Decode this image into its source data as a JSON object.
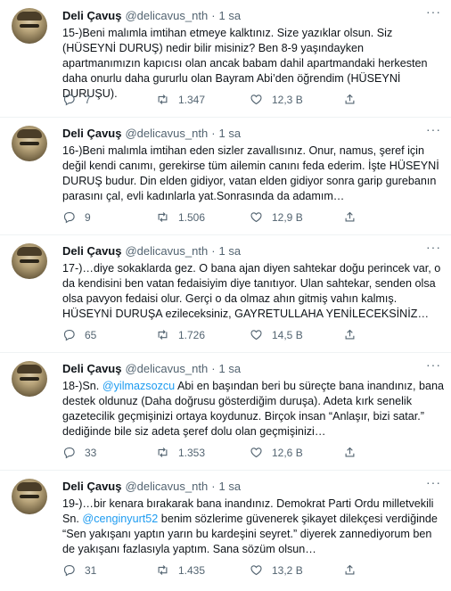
{
  "tweets": [
    {
      "name": "Deli Çavuş",
      "handle": "@delicavus_nth",
      "time": "1 sa",
      "text": "15-)Beni malımla imtihan etmeye kalktınız. Size yazıklar olsun. Siz (HÜSEYNİ DURUŞ) nedir bilir misiniz? Ben 8-9 yaşındayken apartmanımızın kapıcısı olan ancak babam dahil apartmandaki herkesten daha onurlu daha gururlu olan Bayram Abi’den öğrendim (HÜSEYNİ DURUŞU).",
      "replies": "7",
      "retweets": "1.347",
      "likes": "12,3 B"
    },
    {
      "name": "Deli Çavuş",
      "handle": "@delicavus_nth",
      "time": "1 sa",
      "text": "16-)Beni malımla imtihan eden sizler zavallısınız. Onur, namus, şeref için değil kendi canımı, gerekirse tüm ailemin canını feda ederim. İşte HÜSEYNİ DURUŞ budur. Din elden gidiyor, vatan elden gidiyor sonra garip gurebanın parasını çal, evli kadınlarla yat.Sonrasında da adamım…",
      "replies": "9",
      "retweets": "1.506",
      "likes": "12,9 B"
    },
    {
      "name": "Deli Çavuş",
      "handle": "@delicavus_nth",
      "time": "1 sa",
      "text": "17-)…diye sokaklarda gez. O bana ajan diyen sahtekar doğu perincek var, o da kendisini ben vatan fedaisiyim diye tanıtıyor. Ulan sahtekar, senden olsa olsa pavyon fedaisi olur. Gerçi o da olmaz ahın gitmiş vahın kalmış. HÜSEYNİ DURUŞA ezileceksiniz, GAYRETULLAHA YENİLECEKSİNİZ…",
      "replies": "65",
      "retweets": "1.726",
      "likes": "14,5 B"
    },
    {
      "name": "Deli Çavuş",
      "handle": "@delicavus_nth",
      "time": "1 sa",
      "text_before": "18-)Sn. ",
      "mention": "@yilmazsozcu",
      "text_after": " Abi en başından beri bu süreçte bana inandınız, bana destek oldunuz (Daha doğrusu gösterdiğim duruşa). Adeta kırk senelik gazetecilik geçmişinizi ortaya koydunuz. Birçok insan “Anlaşır, bizi satar.” dediğinde bile siz adeta şeref dolu olan geçmişinizi…",
      "replies": "33",
      "retweets": "1.353",
      "likes": "12,6 B"
    },
    {
      "name": "Deli Çavuş",
      "handle": "@delicavus_nth",
      "time": "1 sa",
      "text_before": "19-)…bir kenara bırakarak bana inandınız. Demokrat Parti Ordu milletvekili Sn. ",
      "mention": "@cenginyurt52",
      "text_after": " benim sözlerime güvenerek şikayet dilekçesi verdiğinde “Sen yakışanı yaptın yarın bu kardeşini seyret.” diyerek zannediyorum ben de yakışanı fazlasıyla yaptım. Sana sözüm olsun…",
      "replies": "31",
      "retweets": "1.435",
      "likes": "13,2 B"
    }
  ],
  "colors": {
    "link": "#1d9bf0",
    "muted": "#536471",
    "text": "#0f1419"
  },
  "icons": {
    "reply": "reply-icon",
    "retweet": "retweet-icon",
    "like": "heart-icon",
    "more": "more-icon"
  }
}
